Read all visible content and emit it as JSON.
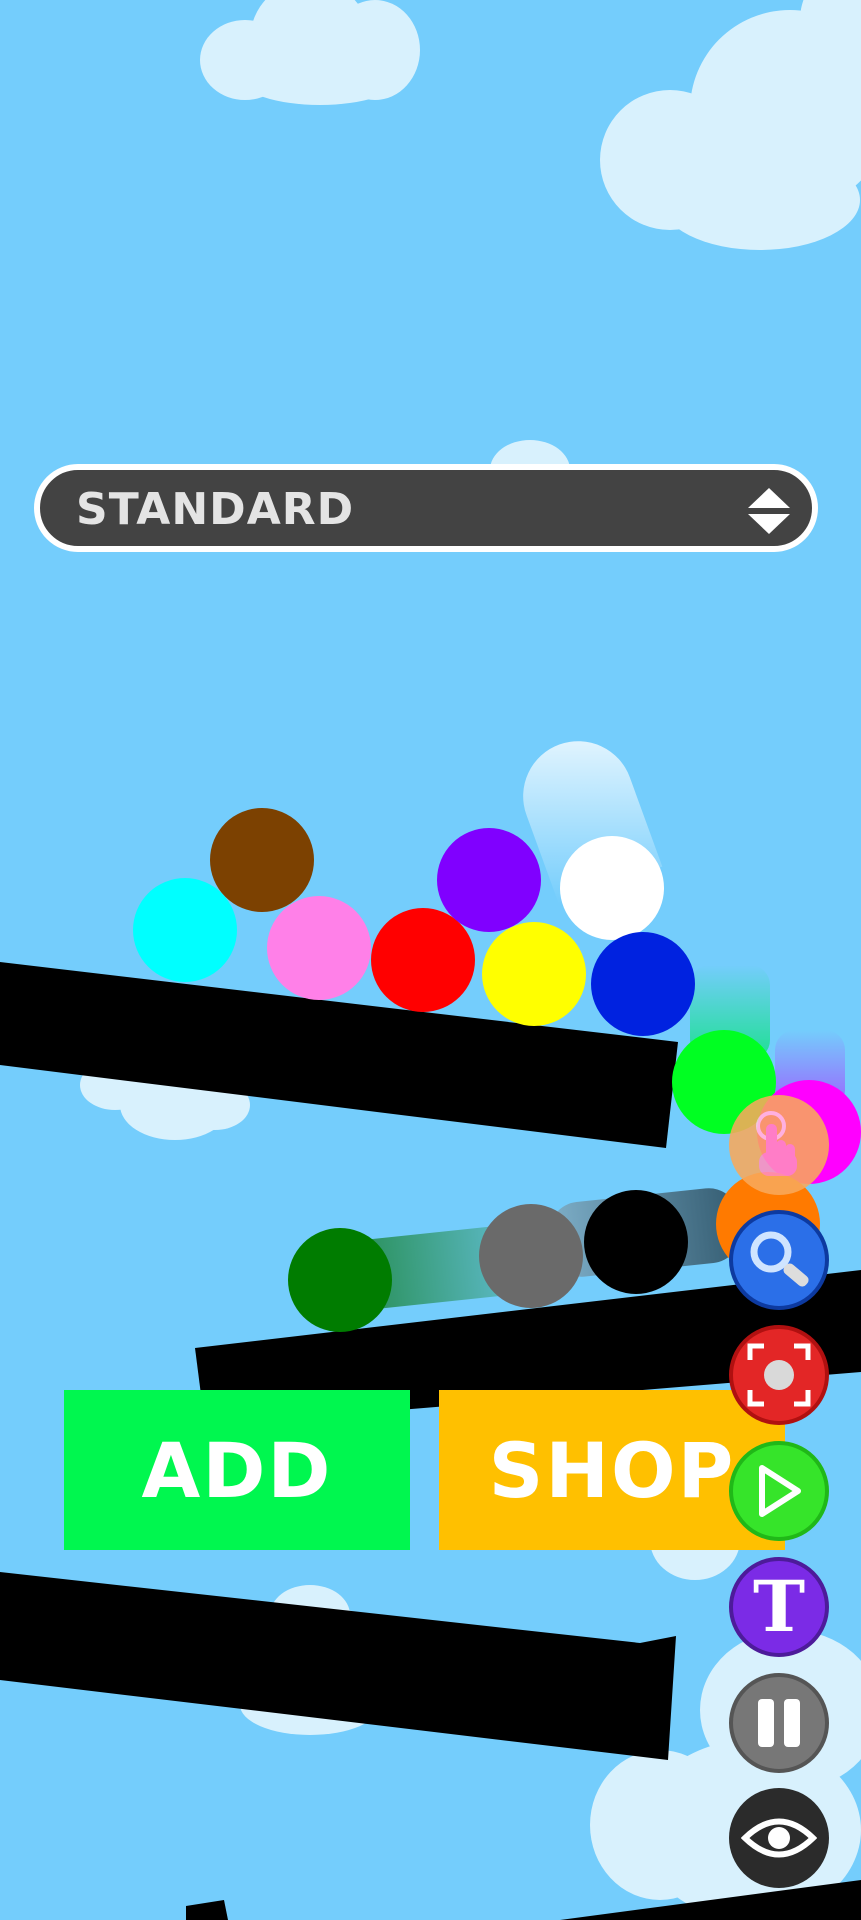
{
  "mode_selector": {
    "label": "STANDARD",
    "icon": "up-down-arrows-icon"
  },
  "buttons": {
    "add_label": "ADD",
    "shop_label": "SHOP"
  },
  "toolbar": {
    "tools": [
      {
        "name": "touch",
        "icon": "hand-pointer-icon",
        "color": "#f9a95c"
      },
      {
        "name": "magnifier",
        "icon": "magnifier-icon",
        "color": "#2b6fe8"
      },
      {
        "name": "screenshot",
        "icon": "screenshot-frame-icon",
        "color": "#e32626"
      },
      {
        "name": "play",
        "icon": "play-icon",
        "color": "#36e42a"
      },
      {
        "name": "text",
        "icon": "letter-t-icon",
        "glyph": "T",
        "color": "#7b2be6"
      },
      {
        "name": "pause",
        "icon": "pause-icon",
        "color": "#777777"
      },
      {
        "name": "view",
        "icon": "eye-icon",
        "color": "#2b2b2b"
      }
    ]
  },
  "balls": [
    {
      "color": "#7c4101"
    },
    {
      "color": "#00ffff"
    },
    {
      "color": "#ff80e8"
    },
    {
      "color": "#ff0000"
    },
    {
      "color": "#8000ff"
    },
    {
      "color": "#ffff00"
    },
    {
      "color": "#ffffff"
    },
    {
      "color": "#0022e0"
    },
    {
      "color": "#00ff22"
    },
    {
      "color": "#ff00ff"
    },
    {
      "color": "#ff7a00"
    },
    {
      "color": "#007c00"
    },
    {
      "color": "#6a6a6a"
    },
    {
      "color": "#000000"
    }
  ],
  "colors": {
    "sky": "#74cdfc",
    "cloud": "#d8f1fd",
    "add_button": "#00f74f",
    "shop_button": "#ffc000",
    "selector_bg": "#434343"
  }
}
